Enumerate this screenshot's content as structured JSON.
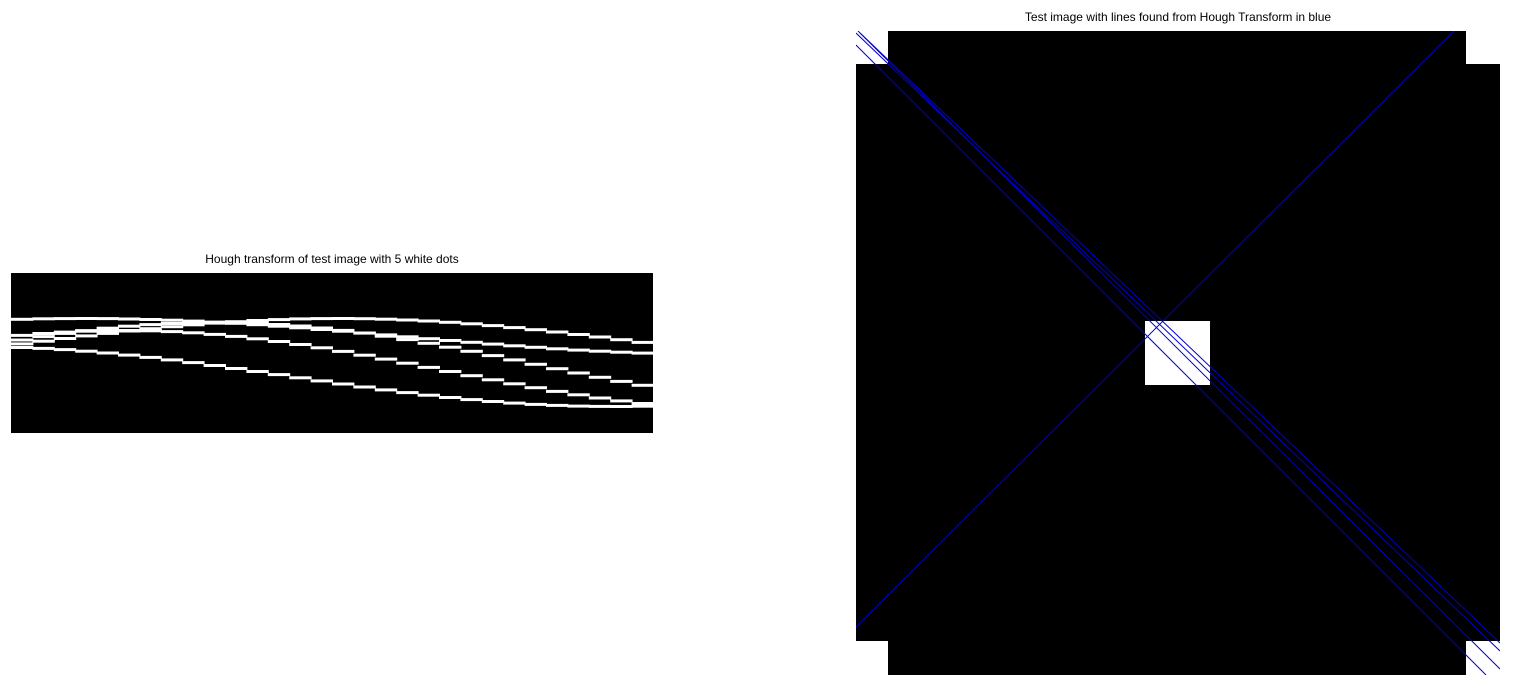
{
  "panels": {
    "left": {
      "title": "Hough transform of test image with 5 white dots",
      "background": "#000000",
      "curve_color": "#ffffff",
      "curve_count": 5
    },
    "right": {
      "title": "Test image with lines found from Hough Transform in blue",
      "background": "#000000",
      "square_color": "#ffffff",
      "line_color": "#0000ff"
    }
  }
}
